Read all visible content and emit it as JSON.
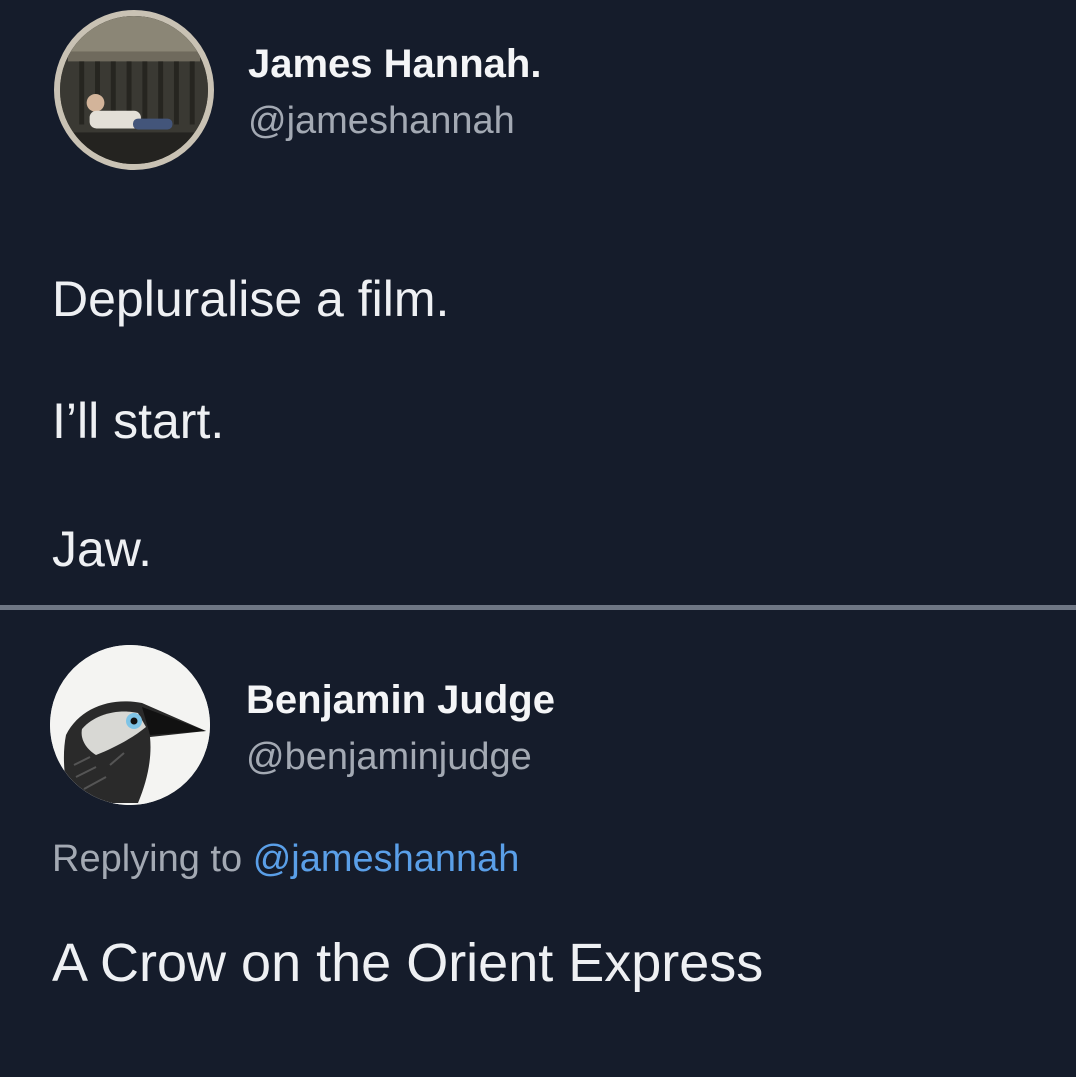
{
  "colors": {
    "background": "#151c2b",
    "primary_text": "#eef0f3",
    "secondary_text": "#a3a9b3",
    "mention": "#5a9fe8",
    "divider": "#6e7684"
  },
  "tweets": [
    {
      "user": {
        "name": "James Hannah.",
        "handle": "@jameshannah",
        "avatar_icon": "person-in-window-photo"
      },
      "lines": [
        "Depluralise a film.",
        "I’ll start.",
        "Jaw."
      ]
    },
    {
      "user": {
        "name": "Benjamin Judge",
        "handle": "@benjaminjudge",
        "avatar_icon": "crow-drawing"
      },
      "replying_prefix": "Replying to",
      "replying_mention": "@jameshannah",
      "text": "A Crow on the Orient Express"
    }
  ]
}
